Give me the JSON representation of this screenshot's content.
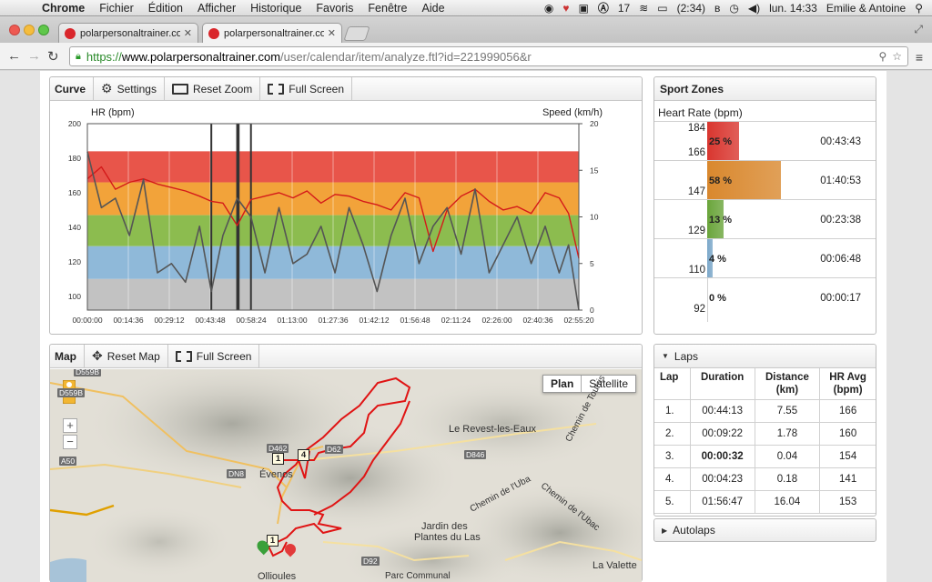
{
  "menubar": {
    "items": [
      "Chrome",
      "Fichier",
      "Édition",
      "Afficher",
      "Historique",
      "Favoris",
      "Fenêtre",
      "Aide"
    ],
    "status": {
      "badge_count": "17",
      "battery": "(2:34)",
      "clock": "lun. 14:33",
      "user": "Emilie & Antoine"
    }
  },
  "browser": {
    "tabs": [
      {
        "label": "polarpersonaltrainer.com"
      },
      {
        "label": "polarpersonaltrainer.com"
      }
    ],
    "url": {
      "scheme": "https://",
      "host": "www.polarpersonaltrainer.com",
      "path": "/user/calendar/item/analyze.ftl?id=221999056&r"
    }
  },
  "curve_panel": {
    "title": "Curve",
    "settings_label": "Settings",
    "reset_zoom_label": "Reset Zoom",
    "full_screen_label": "Full Screen"
  },
  "chart_data": {
    "type": "line",
    "ylabel": "HR (bpm)",
    "y2label": "Speed (km/h)",
    "ylim": [
      92,
      200
    ],
    "y2lim": [
      0,
      20
    ],
    "yticks": [
      "200",
      "180",
      "160",
      "140",
      "120",
      "100"
    ],
    "y2ticks": [
      "20",
      "15",
      "10",
      "5",
      "0"
    ],
    "xticks": [
      "00:00:00",
      "00:14:36",
      "00:29:12",
      "00:43:48",
      "00:58:24",
      "01:13:00",
      "01:27:36",
      "01:42:12",
      "01:56:48",
      "02:11:24",
      "02:26:00",
      "02:40:36",
      "02:55:20"
    ],
    "zone_bands": [
      {
        "from": 166,
        "to": 184,
        "color": "#e8554a"
      },
      {
        "from": 147,
        "to": 166,
        "color": "#f2a33a"
      },
      {
        "from": 129,
        "to": 147,
        "color": "#8cbc4f"
      },
      {
        "from": 110,
        "to": 129,
        "color": "#8fb9d9"
      },
      {
        "from": 92,
        "to": 110,
        "color": "#c2c2c2"
      }
    ],
    "lap_markers_seconds": [
      2653,
      3206,
      3238,
      3501
    ],
    "duration_seconds": 10520,
    "series": [
      {
        "name": "HR (bpm)",
        "color": "#d41a1a",
        "axis": "left",
        "x": [
          0,
          300,
          600,
          900,
          1200,
          1500,
          1800,
          2100,
          2400,
          2653,
          2900,
          3206,
          3500,
          3800,
          4100,
          4400,
          4700,
          5000,
          5300,
          5600,
          5900,
          6200,
          6500,
          6800,
          7100,
          7400,
          7700,
          8000,
          8300,
          8600,
          8900,
          9200,
          9500,
          9800,
          10100,
          10300,
          10520
        ],
        "values": [
          168,
          175,
          162,
          166,
          168,
          165,
          163,
          161,
          158,
          155,
          154,
          141,
          156,
          158,
          160,
          157,
          161,
          154,
          159,
          158,
          155,
          153,
          150,
          160,
          157,
          126,
          150,
          158,
          162,
          155,
          150,
          152,
          148,
          160,
          157,
          148,
          122
        ]
      },
      {
        "name": "Speed (km/h)",
        "color": "#555555",
        "axis": "right",
        "x": [
          0,
          300,
          600,
          900,
          1200,
          1500,
          1800,
          2100,
          2400,
          2653,
          2900,
          3206,
          3500,
          3800,
          4100,
          4400,
          4700,
          5000,
          5300,
          5600,
          5900,
          6200,
          6500,
          6800,
          7100,
          7400,
          7700,
          8000,
          8300,
          8600,
          8900,
          9200,
          9500,
          9800,
          10100,
          10300,
          10520
        ],
        "values": [
          17,
          11,
          12,
          8,
          14,
          4,
          5,
          3,
          9,
          2,
          8,
          12,
          10,
          4,
          11,
          5,
          6,
          9,
          4,
          11,
          7,
          2,
          8,
          12,
          5,
          9,
          11,
          6,
          13,
          4,
          7,
          10,
          5,
          9,
          4,
          7,
          0
        ]
      }
    ]
  },
  "zones_panel": {
    "title": "Sport Zones",
    "subtitle": "Heart Rate (bpm)",
    "zones": [
      {
        "upper": "184",
        "lower": "166",
        "percent": "25 %",
        "pct_value": 25,
        "time": "00:43:43",
        "color": "#d9362f"
      },
      {
        "upper": "",
        "lower": "147",
        "percent": "58 %",
        "pct_value": 58,
        "time": "01:40:53",
        "color": "#d9882e"
      },
      {
        "upper": "",
        "lower": "129",
        "percent": "13 %",
        "pct_value": 13,
        "time": "00:23:38",
        "color": "#6aa53b"
      },
      {
        "upper": "",
        "lower": "110",
        "percent": "4 %",
        "pct_value": 4,
        "time": "00:06:48",
        "color": "#7aa7c9"
      },
      {
        "upper": "",
        "lower": "92",
        "percent": "0 %",
        "pct_value": 0,
        "time": "00:00:17",
        "color": "#b0b0b0"
      }
    ]
  },
  "map_panel": {
    "title": "Map",
    "reset_map_label": "Reset Map",
    "full_screen_label": "Full Screen",
    "plan_label": "Plan",
    "satellite_label": "Satellite",
    "zoom_in": "+",
    "zoom_out": "−",
    "places": {
      "revest": "Le Revest-les-Eaux",
      "evenos": "Évenos",
      "jardin1": "Jardin des",
      "jardin2": "Plantes du Las",
      "ollioules": "Ollioules",
      "parc": "Parc Communal",
      "valette": "La Valette",
      "uba1": "Chemin de l'Uba",
      "uba2": "Chemin de l'Ubac",
      "tourris": "Chemin de Tourris"
    },
    "roads": [
      "D559B",
      "A50",
      "DN8",
      "D462",
      "D62",
      "D846",
      "D92",
      "D62"
    ],
    "flags": [
      "1",
      "4",
      "1"
    ]
  },
  "laps_panel": {
    "title": "Laps",
    "columns": [
      {
        "line1": "Lap",
        "line2": ""
      },
      {
        "line1": "Duration",
        "line2": ""
      },
      {
        "line1": "Distance",
        "line2": "(km)"
      },
      {
        "line1": "HR Avg",
        "line2": "(bpm)"
      }
    ],
    "rows": [
      {
        "lap": "1.",
        "duration": "00:44:13",
        "distance": "7.55",
        "hr": "166"
      },
      {
        "lap": "2.",
        "duration": "00:09:22",
        "distance": "1.78",
        "hr": "160"
      },
      {
        "lap": "3.",
        "duration": "00:00:32",
        "distance": "0.04",
        "hr": "154"
      },
      {
        "lap": "4.",
        "duration": "00:04:23",
        "distance": "0.18",
        "hr": "141"
      },
      {
        "lap": "5.",
        "duration": "01:56:47",
        "distance": "16.04",
        "hr": "153"
      }
    ],
    "autolaps_label": "Autolaps"
  }
}
